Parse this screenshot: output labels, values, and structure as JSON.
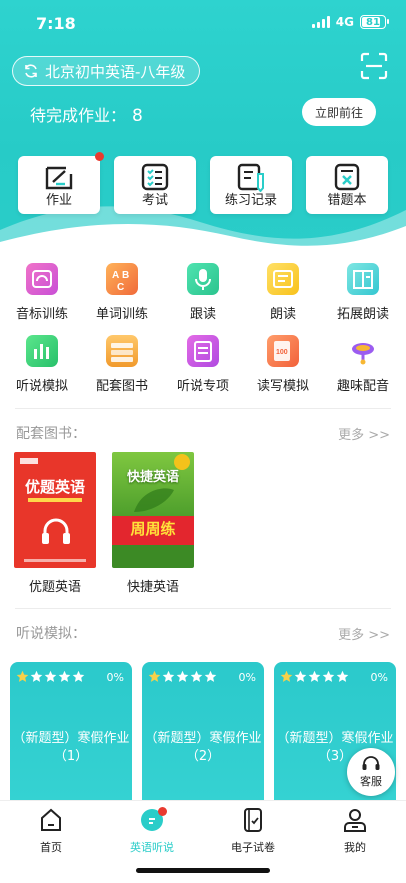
{
  "status_bar": {
    "time": "7:18",
    "network": "4G",
    "battery": "81"
  },
  "header": {
    "grade_selector": "北京初中英语-八年级",
    "pending_label": "待完成作业：",
    "pending_count": "8",
    "goto_label": "立即前往"
  },
  "quick_actions": [
    {
      "label": "作业",
      "icon": "homework-icon"
    },
    {
      "label": "考试",
      "icon": "exam-checklist-icon"
    },
    {
      "label": "练习记录",
      "icon": "practice-record-icon"
    },
    {
      "label": "错题本",
      "icon": "mistakes-book-icon"
    }
  ],
  "functions": [
    {
      "label": "音标训练",
      "icon": "phonetics-icon"
    },
    {
      "label": "单词训练",
      "icon": "word-training-icon"
    },
    {
      "label": "跟读",
      "icon": "microphone-icon"
    },
    {
      "label": "朗读",
      "icon": "read-aloud-icon"
    },
    {
      "label": "拓展朗读",
      "icon": "extended-reading-icon"
    },
    {
      "label": "听说模拟",
      "icon": "listening-speaking-icon"
    },
    {
      "label": "配套图书",
      "icon": "books-stack-icon"
    },
    {
      "label": "听说专项",
      "icon": "special-topic-icon"
    },
    {
      "label": "读写模拟",
      "icon": "read-write-icon"
    },
    {
      "label": "趣味配音",
      "icon": "dubbing-icon"
    }
  ],
  "books_section": {
    "title": "配套图书：",
    "more": "更多 >>",
    "books": [
      {
        "title": "优题英语",
        "cover_text": "优题英语"
      },
      {
        "title": "快捷英语",
        "cover_text": "快捷英语",
        "cover_sub": "周周练"
      }
    ]
  },
  "practice_section": {
    "title": "听说模拟：",
    "more": "更多 >>",
    "cards": [
      {
        "title": "（新题型）寒假作业（1）",
        "progress": "0%",
        "stars": 1
      },
      {
        "title": "（新题型）寒假作业（2）",
        "progress": "0%",
        "stars": 1
      },
      {
        "title": "（新题型）寒假作业（3）",
        "progress": "0%",
        "stars": 1
      }
    ]
  },
  "service_label": "客服",
  "tabs": [
    {
      "label": "首页",
      "icon": "home-icon",
      "active": false
    },
    {
      "label": "英语听说",
      "icon": "english-listening-icon",
      "active": true
    },
    {
      "label": "电子试卷",
      "icon": "e-paper-icon",
      "active": false
    },
    {
      "label": "我的",
      "icon": "profile-icon",
      "active": false
    }
  ],
  "colors": {
    "accent": "#2acdc9",
    "badge": "#e93a2f"
  }
}
